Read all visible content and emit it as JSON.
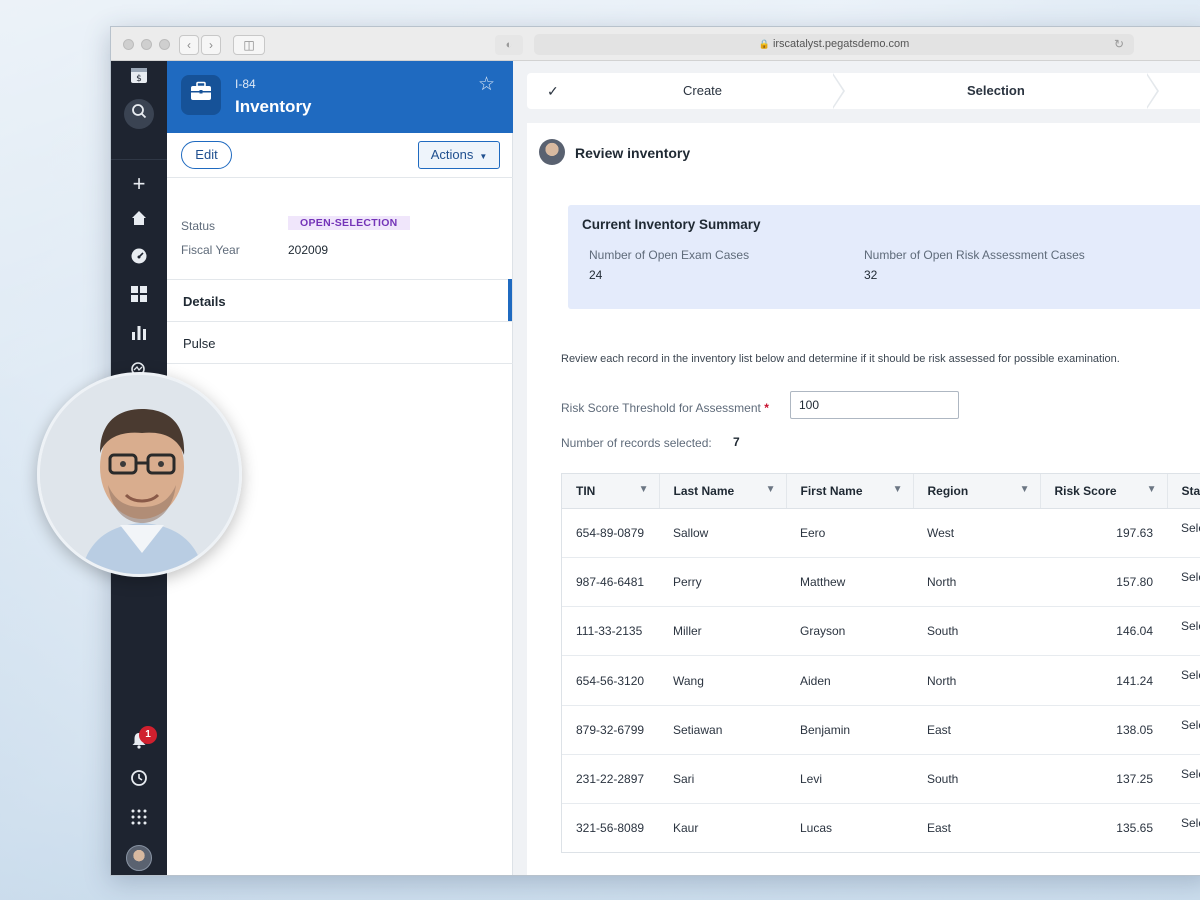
{
  "browser": {
    "url": "irscatalyst.pegatsdemo.com"
  },
  "rail": {
    "notification_count": "1",
    "icons": [
      "app-logo-icon",
      "search-icon",
      "plus-icon",
      "home-icon",
      "gauge-icon",
      "dashboard-icon",
      "bar-chart-icon",
      "explore-icon",
      "bell-icon",
      "history-icon",
      "apps-grid-icon",
      "user-avatar"
    ]
  },
  "case": {
    "id": "I-84",
    "title": "Inventory",
    "edit_label": "Edit",
    "actions_label": "Actions",
    "status_label": "Status",
    "status_value": "OPEN-SELECTION",
    "fiscal_year_label": "Fiscal Year",
    "fiscal_year_value": "202009",
    "tabs": [
      {
        "label": "Details"
      },
      {
        "label": "Pulse"
      }
    ]
  },
  "stepper": {
    "steps": [
      {
        "label": "Create"
      },
      {
        "label": "Selection"
      }
    ]
  },
  "review": {
    "title": "Review inventory",
    "summary_title": "Current Inventory Summary",
    "open_exam_label": "Number of Open Exam Cases",
    "open_exam_value": "24",
    "open_risk_label": "Number of Open Risk Assessment Cases",
    "open_risk_value": "32",
    "instructions": "Review each record in the inventory list below and determine if it should be risk assessed for possible examination.",
    "threshold_label": "Risk Score Threshold for Assessment",
    "threshold_value": "100",
    "selected_label": "Number of records selected:",
    "selected_count": "7"
  },
  "table": {
    "headers": [
      "TIN",
      "Last Name",
      "First Name",
      "Region",
      "Risk Score",
      "Status"
    ],
    "rows": [
      {
        "tin": "654-89-0879",
        "last": "Sallow",
        "first": "Eero",
        "region": "West",
        "score": "197.63",
        "status": "Selected"
      },
      {
        "tin": "987-46-6481",
        "last": "Perry",
        "first": "Matthew",
        "region": "North",
        "score": "157.80",
        "status": "Selected"
      },
      {
        "tin": "111-33-2135",
        "last": "Miller",
        "first": "Grayson",
        "region": "South",
        "score": "146.04",
        "status": "Selected"
      },
      {
        "tin": "654-56-3120",
        "last": "Wang",
        "first": "Aiden",
        "region": "North",
        "score": "141.24",
        "status": "Selected"
      },
      {
        "tin": "879-32-6799",
        "last": "Setiawan",
        "first": "Benjamin",
        "region": "East",
        "score": "138.05",
        "status": "Selected"
      },
      {
        "tin": "231-22-2897",
        "last": "Sari",
        "first": "Levi",
        "region": "South",
        "score": "137.25",
        "status": "Selected"
      },
      {
        "tin": "321-56-8089",
        "last": "Kaur",
        "first": "Lucas",
        "region": "East",
        "score": "135.65",
        "status": "Selected"
      }
    ]
  },
  "colors": {
    "brand_blue": "#1f6ac0",
    "rail_dark": "#1e2430",
    "status_purple": "#7434b8",
    "summary_bg": "#e4ebfb",
    "badge_red": "#d0202e"
  }
}
